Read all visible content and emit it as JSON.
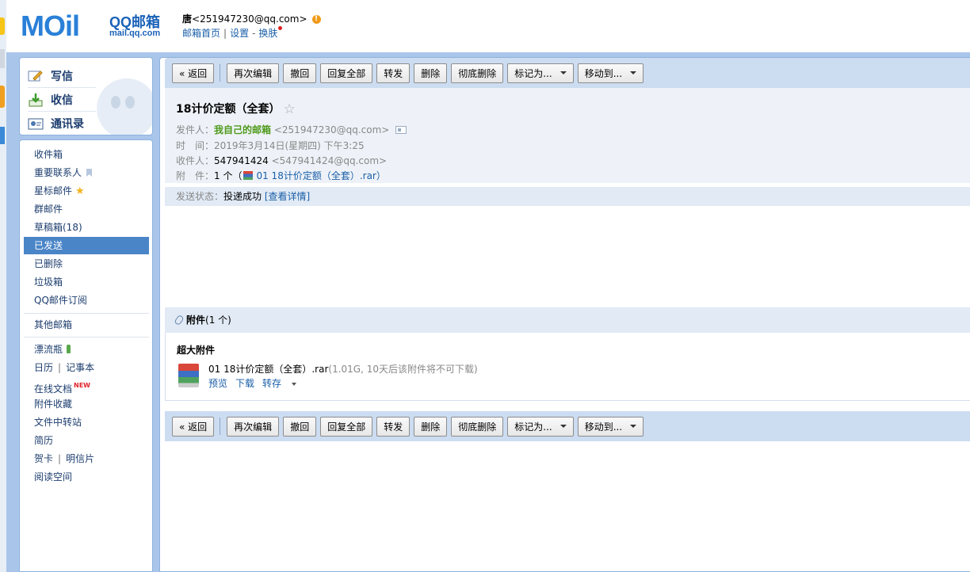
{
  "header": {
    "logo_text": "MOil",
    "logo_brand": "QQ邮箱",
    "logo_url": "mail.qq.com",
    "user_name": "唐",
    "user_email": "<251947230@qq.com>",
    "links": [
      "邮箱首页",
      "设置",
      "换肤"
    ]
  },
  "quick": {
    "write": "写信",
    "receive": "收信",
    "contacts": "通讯录"
  },
  "folders": {
    "inbox": "收件箱",
    "important": "重要联系人",
    "starred": "星标邮件",
    "group": "群邮件",
    "drafts": "草稿箱(18)",
    "sent": "已发送",
    "deleted": "已删除",
    "spam": "垃圾箱",
    "subscriptions": "QQ邮件订阅",
    "other": "其他邮箱",
    "bottle": "漂流瓶",
    "calendar": "日历",
    "notes": "记事本",
    "docs": "在线文档",
    "docs_badge": "NEW",
    "attach_fav": "附件收藏",
    "file_transfer": "文件中转站",
    "resume": "简历",
    "cards": "贺卡",
    "postcards": "明信片",
    "reading": "阅读空间"
  },
  "toolbar": {
    "back": "« 返回",
    "reedit": "再次编辑",
    "recall": "撤回",
    "reply_all": "回复全部",
    "forward": "转发",
    "delete": "删除",
    "delete_forever": "彻底删除",
    "mark_as": "标记为...",
    "move_to": "移动到..."
  },
  "mail": {
    "subject": "18计价定额（全套）",
    "from_label": "发件人：",
    "from_name": "我自己的邮箱",
    "from_email": "<251947230@qq.com>",
    "time_label": "时　间：",
    "time_value": "2019年3月14日(星期四) 下午3:25",
    "to_label": "收件人：",
    "to_name": "547941424",
    "to_email": "<547941424@qq.com>",
    "attach_label": "附　件：",
    "attach_count": "1 个（",
    "attach_name": "01 18计价定额（全套）.rar",
    "attach_close": "）",
    "status_label": "发送状态：",
    "status_value": "投递成功",
    "status_link": "[查看详情]"
  },
  "attachments": {
    "title": "附件",
    "count": "(1 个)",
    "big_title": "超大附件",
    "file_name": "01 18计价定额（全套）.rar",
    "file_info": "(1.01G, 10天后该附件将不可下载)",
    "preview": "预览",
    "download": "下载",
    "save_to": "转存"
  }
}
